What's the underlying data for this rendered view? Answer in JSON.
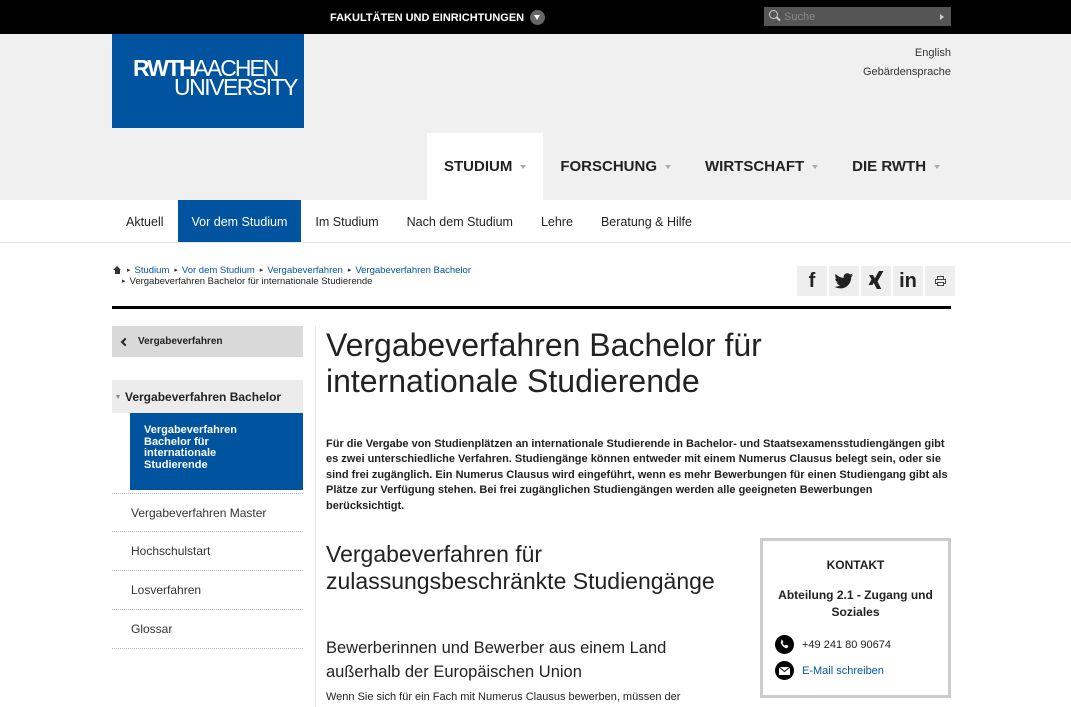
{
  "topbar": {
    "faculties_label": "FAKULTÄTEN UND EINRICHTUNGEN",
    "search_placeholder": "Suche"
  },
  "logo": {
    "part1": "RWTH",
    "part2": "AACHEN",
    "part3": "UNIVERSITY"
  },
  "languages": [
    "English",
    "Gebärdensprache"
  ],
  "main_nav": [
    {
      "label": "STUDIUM",
      "active": true
    },
    {
      "label": "FORSCHUNG",
      "active": false
    },
    {
      "label": "WIRTSCHAFT",
      "active": false
    },
    {
      "label": "DIE RWTH",
      "active": false
    }
  ],
  "sub_nav": [
    {
      "label": "Aktuell",
      "active": false
    },
    {
      "label": "Vor dem Studium",
      "active": true
    },
    {
      "label": "Im Studium",
      "active": false
    },
    {
      "label": "Nach dem Studium",
      "active": false
    },
    {
      "label": "Lehre",
      "active": false
    },
    {
      "label": "Beratung & Hilfe",
      "active": false
    }
  ],
  "breadcrumb": {
    "links": [
      "Studium",
      "Vor dem Studium",
      "Vergabeverfahren",
      "Vergabeverfahren Bachelor"
    ],
    "current": "Vergabeverfahren Bachelor für internationale Studierende"
  },
  "share": {
    "facebook": "f",
    "twitter": "twitter-icon",
    "xing": "X",
    "linkedin": "in",
    "print": "print-icon"
  },
  "sidebar": {
    "back_label": "Vergabeverfahren",
    "parent_label": "Vergabeverfahren Bachelor",
    "active_label": "Vergabeverfahren Bachelor für internationale Studierende",
    "items": [
      "Vergabeverfahren Master",
      "Hochschulstart",
      "Losverfahren",
      "Glossar"
    ]
  },
  "content": {
    "title": "Vergabeverfahren Bachelor für internationale Studierende",
    "lead": "Für die Vergabe von Studienplätzen an internationale Studierende in Bachelor- und Staatsexamensstudiengängen gibt es zwei unterschiedliche Verfahren. Studiengänge können entweder mit einem Numerus Clausus belegt sein, oder sie sind frei zugänglich. Ein Numerus Clausus wird eingeführt, wenn es mehr Bewerbungen für einen Studiengang gibt als Plätze zur Verfügung stehen. Bei frei zugänglichen Studiengängen werden alle geeigneten Bewerbungen berücksichtigt.",
    "h2": "Vergabeverfahren für zulassungsbeschränkte Studiengänge",
    "h3": "Bewerberinnen und Bewerber aus einem Land außerhalb der Europäischen Union",
    "body": "Wenn Sie sich für ein Fach mit Numerus Clausus bewerben, müssen der"
  },
  "contact": {
    "title": "KONTAKT",
    "department": "Abteilung 2.1 - Zugang und Soziales",
    "phone": "+49 241 80 90674",
    "email_label": "E-Mail schreiben"
  },
  "colors": {
    "brand_blue": "#00549f",
    "header_grey": "#f0f0f0"
  }
}
